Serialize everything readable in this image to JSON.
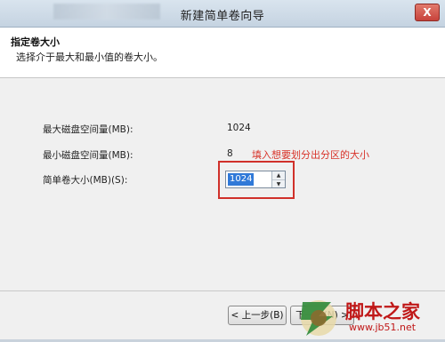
{
  "window": {
    "title": "新建简单卷向导",
    "close_glyph": "X"
  },
  "header": {
    "title": "指定卷大小",
    "subtitle": "选择介于最大和最小值的卷大小。"
  },
  "fields": {
    "max_label": "最大磁盘空间量(MB):",
    "max_value": "1024",
    "min_label": "最小磁盘空间量(MB):",
    "min_value": "8",
    "size_label": "简单卷大小(MB)(S):",
    "size_value": "1024"
  },
  "annotation": "填入想要划分出分区的大小",
  "footer": {
    "back_label": "< 上一步(B)",
    "next_label": "下一步(N) >"
  },
  "watermark": {
    "brand": "脚本之家",
    "url": "www.jb51.net"
  },
  "colors": {
    "annotation": "#d8332a",
    "selection": "#3079d8",
    "watermark": "#c01818"
  }
}
